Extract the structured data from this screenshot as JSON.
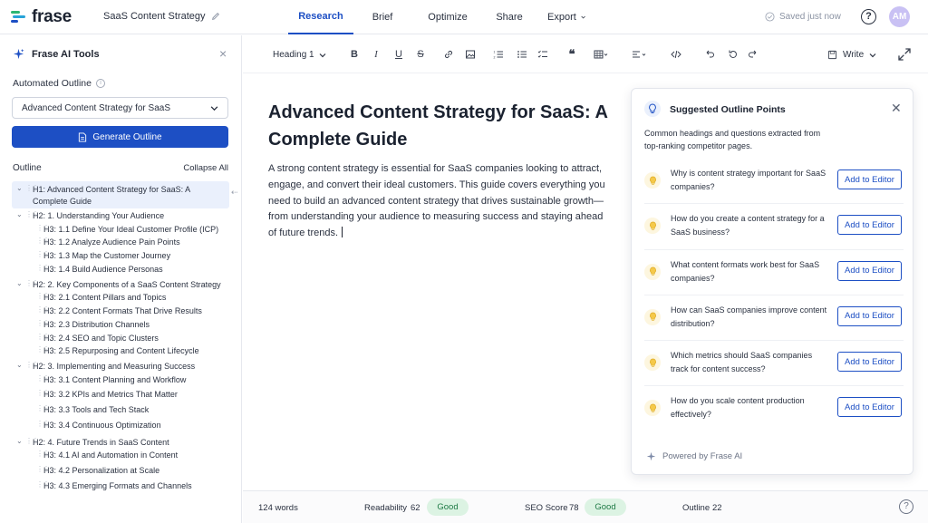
{
  "app": {
    "logo_text": "frase",
    "doc_title": "SaaS Content Strategy"
  },
  "nav": {
    "tabs": [
      {
        "label": "Research",
        "active": true
      },
      {
        "label": "Brief",
        "active": false
      },
      {
        "label": "Optimize",
        "active": false
      },
      {
        "label": "Share",
        "active": false
      },
      {
        "label": "Export",
        "active": false
      }
    ]
  },
  "status": {
    "saved": "Saved just now"
  },
  "user": {
    "initials": "AM"
  },
  "left_panel": {
    "title": "Frase AI Tools",
    "automated_outline_label": "Automated Outline",
    "select_value": "Advanced Content Strategy for SaaS",
    "generate_label": "Generate Outline",
    "outline_label": "Outline",
    "collapse_label": "Collapse All",
    "outline": [
      {
        "level": "h1",
        "text": "H1: Advanced Content Strategy for SaaS: A Complete Guide"
      },
      {
        "level": "h2",
        "text": "H2: 1. Understanding Your Audience"
      },
      {
        "level": "h3",
        "text": "H3: 1.1 Define Your Ideal Customer Profile (ICP)"
      },
      {
        "level": "h3",
        "text": "H3: 1.2 Analyze Audience Pain Points"
      },
      {
        "level": "h3",
        "text": "H3: 1.3 Map the Customer Journey"
      },
      {
        "level": "h3",
        "text": "H3: 1.4 Build Audience Personas"
      },
      {
        "level": "h2",
        "text": "H2: 2. Key Components of a SaaS Content Strategy"
      },
      {
        "level": "h3",
        "text": "H3: 2.1 Content Pillars and Topics"
      },
      {
        "level": "h3",
        "text": "H3: 2.2 Content Formats That Drive Results"
      },
      {
        "level": "h3",
        "text": "H3: 2.3 Distribution Channels"
      },
      {
        "level": "h3",
        "text": "H3: 2.4 SEO and Topic Clusters"
      },
      {
        "level": "h3",
        "text": "H3: 2.5 Repurposing and Content Lifecycle"
      },
      {
        "level": "h2",
        "text": "H2: 3. Implementing and Measuring Success"
      },
      {
        "level": "h3b",
        "text": "H3: 3.1 Content Planning and Workflow"
      },
      {
        "level": "h3b",
        "text": "H3: 3.2 KPIs and Metrics That Matter"
      },
      {
        "level": "h3b",
        "text": "H3: 3.3 Tools and Tech Stack"
      },
      {
        "level": "h3b",
        "text": "H3: 3.4 Continuous Optimization"
      },
      {
        "level": "h2",
        "text": "H2: 4. Future Trends in SaaS Content"
      },
      {
        "level": "h3b",
        "text": "H3: 4.1 AI and Automation in Content"
      },
      {
        "level": "h3b",
        "text": "H3: 4.2 Personalization at Scale"
      },
      {
        "level": "h3b",
        "text": "H3: 4.3 Emerging Formats and Channels"
      }
    ]
  },
  "toolbar": {
    "heading_select": "Heading 1",
    "write_label": "Write"
  },
  "document": {
    "title": "Advanced Content Strategy for SaaS: A Complete Guide",
    "paragraph": "A strong content strategy is essential for SaaS companies looking to attract, engage, and convert their ideal customers. This guide covers everything you need to build an advanced content strategy that drives sustainable growth—from understanding your audience to measuring success and staying ahead of future trends."
  },
  "suggestions": {
    "title": "Suggested Outline Points",
    "description": "Common headings and questions extracted from top-ranking competitor pages.",
    "add_label": "Add to Editor",
    "items": [
      {
        "question": "Why is content strategy important for SaaS companies?"
      },
      {
        "question": "How do you create a content strategy for a SaaS business?"
      },
      {
        "question": "What content formats work best for SaaS companies?"
      },
      {
        "question": "How can SaaS companies improve content distribution?"
      },
      {
        "question": "Which metrics should SaaS companies track for content success?"
      },
      {
        "question": "How do you scale content production effectively?"
      }
    ],
    "powered_by": "Powered by Frase AI"
  },
  "statusbar": {
    "words": "124 words",
    "readability_label": "Readability",
    "readability_value": "62",
    "readability_badge": "Good",
    "seo_label": "SEO Score",
    "seo_value": "78",
    "seo_badge": "Good",
    "outline_label": "Outline",
    "outline_value": "22"
  },
  "colors": {
    "accent": "#1d4fc4",
    "brand_green": "#2bb673",
    "good_badge": "#dcf3e3"
  }
}
